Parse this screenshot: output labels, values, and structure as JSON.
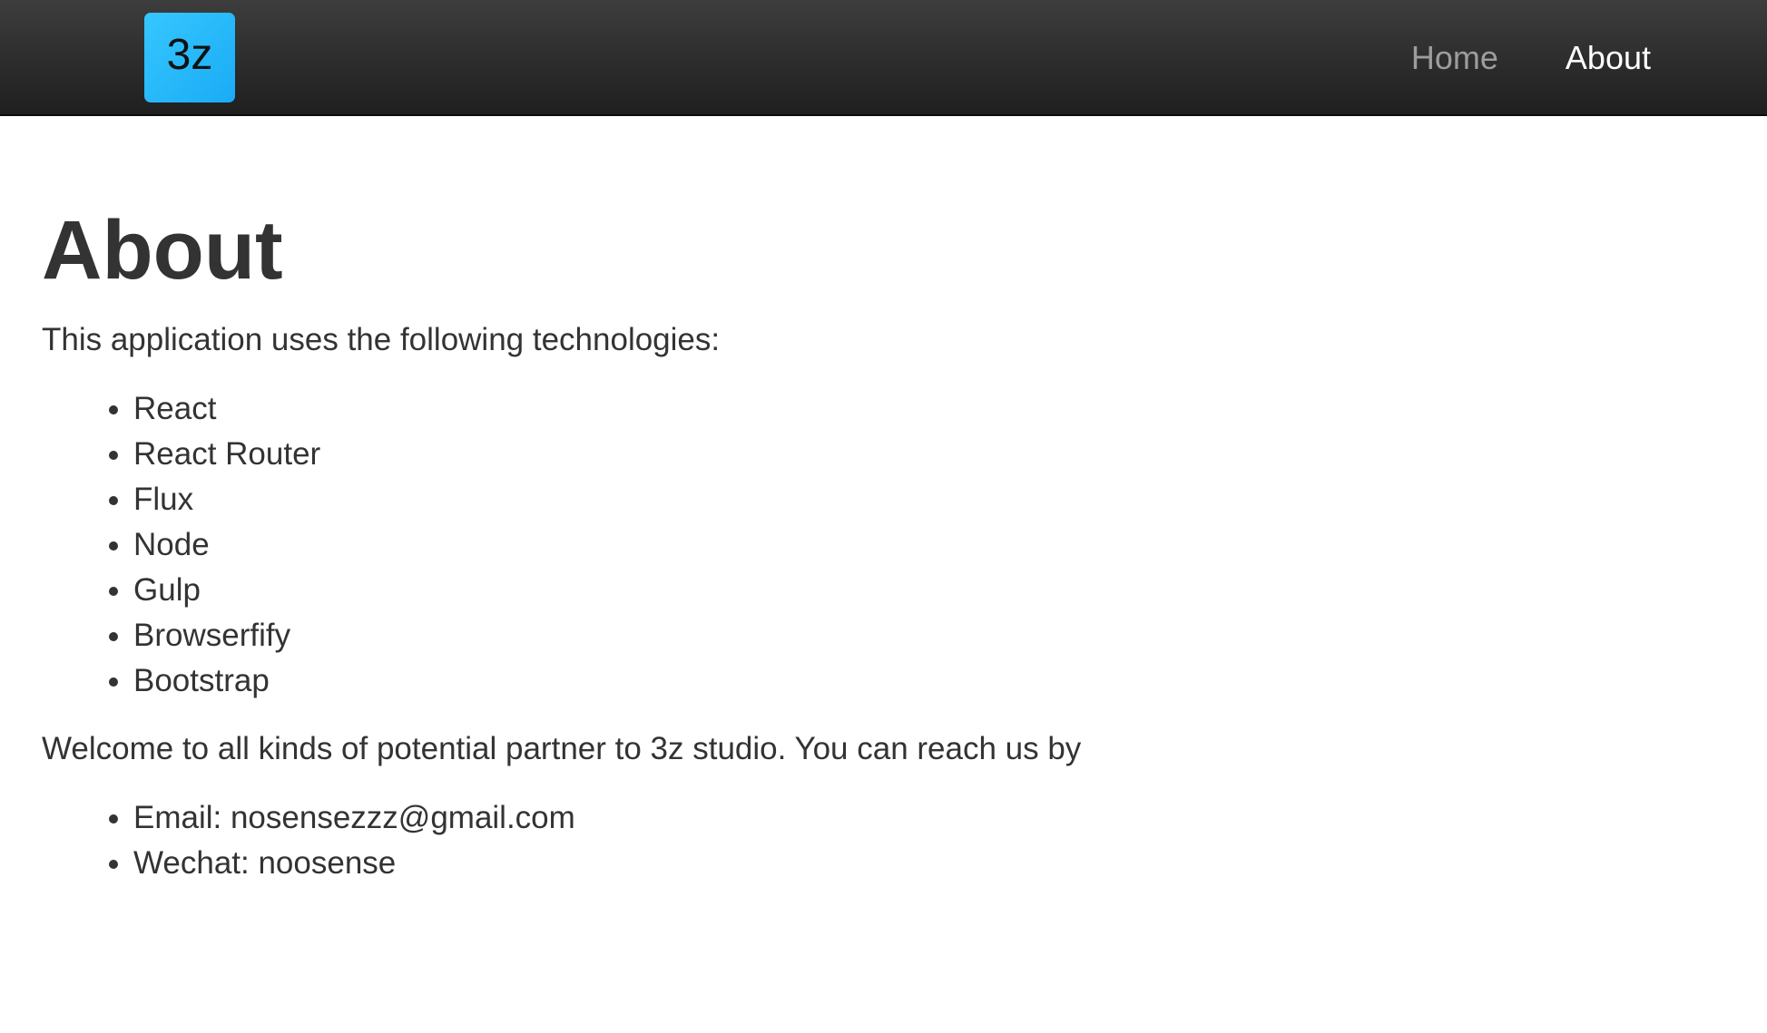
{
  "navbar": {
    "brand": "3z",
    "links": [
      {
        "label": "Home",
        "active": false
      },
      {
        "label": "About",
        "active": true
      }
    ],
    "colors": {
      "brand_bg": "#1fb6ff",
      "bar_bg": "#2e2e2e",
      "link_inactive": "#9d9d9d",
      "link_active": "#ffffff"
    }
  },
  "main": {
    "title": "About",
    "intro": "This application uses the following technologies:",
    "technologies": [
      "React",
      "React Router",
      "Flux",
      "Node",
      "Gulp",
      "Browserfify",
      "Bootstrap"
    ],
    "welcome": "Welcome to all kinds of potential partner to 3z studio. You can reach us by",
    "contacts": [
      "Email: nosensezzz@gmail.com",
      "Wechat: noosense"
    ]
  }
}
